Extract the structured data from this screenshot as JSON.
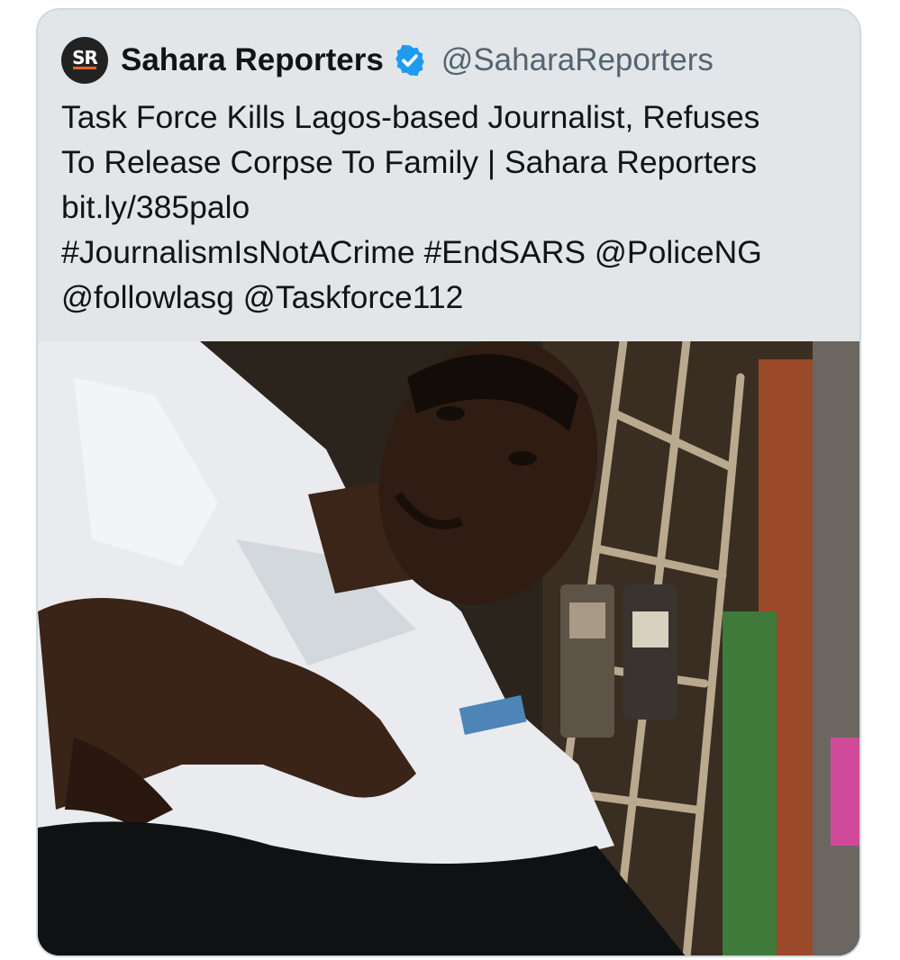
{
  "tweet": {
    "author": {
      "avatar_text": "SR",
      "display_name": "Sahara Reporters",
      "handle": "@SaharaReporters",
      "verified_icon": "verified-badge-icon"
    },
    "text_lines": [
      "Task Force Kills Lagos-based Journalist, Refuses",
      "To Release Corpse To Family | Sahara Reporters",
      "bit.ly/385palo",
      "#JournalismIsNotACrime #EndSARS @PoliceNG",
      "@followlasg @Taskforce112"
    ],
    "media": {
      "type": "photo"
    }
  },
  "colors": {
    "card_background": "#e3e6e8",
    "border": "#cfd9de",
    "verified_blue": "#1d9bf0",
    "logo_accent": "#e9632a"
  }
}
